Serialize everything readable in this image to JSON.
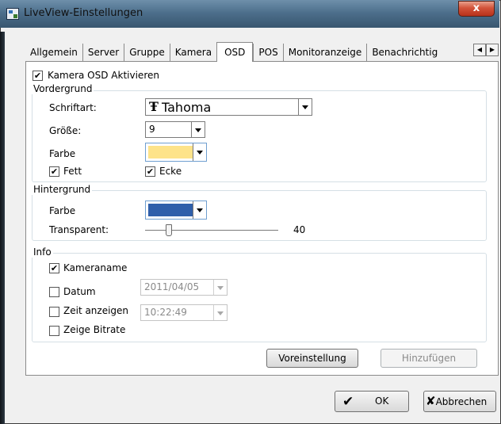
{
  "window": {
    "title": "LiveView-Einstellungen",
    "close_glyph": "x"
  },
  "tabs": [
    {
      "label": "Allgemein",
      "active": false
    },
    {
      "label": "Server",
      "active": false
    },
    {
      "label": "Gruppe",
      "active": false
    },
    {
      "label": "Kamera",
      "active": false
    },
    {
      "label": "OSD",
      "active": true
    },
    {
      "label": "POS",
      "active": false
    },
    {
      "label": "Monitoranzeige",
      "active": false
    },
    {
      "label": "Benachrichtig",
      "active": false
    }
  ],
  "tab_scroll": {
    "left": "◀",
    "right": "▶"
  },
  "osd": {
    "enable_label": "Kamera OSD Aktivieren",
    "enable_checked": true,
    "check_mark": "✔",
    "foreground": {
      "title": "Vordergrund",
      "font_label": "Schriftart:",
      "font_icon": "Ŧ",
      "font_value": "Tahoma",
      "size_label": "Größe:",
      "size_value": "9",
      "color_label": "Farbe",
      "color": "#fde38a",
      "bold_label": "Fett",
      "bold_checked": true,
      "corner_label": "Ecke",
      "corner_checked": true
    },
    "background": {
      "title": "Hintergrund",
      "color_label": "Farbe",
      "color": "#2f5faa",
      "transparent_label": "Transparent:",
      "transparent_value": "40",
      "transparent_fraction": 0.18
    },
    "info": {
      "title": "Info",
      "camera_name_label": "Kameraname",
      "camera_name_checked": true,
      "date_label": "Datum",
      "date_checked": false,
      "date_value": "2011/04/05",
      "time_label": "Zeit anzeigen",
      "time_checked": false,
      "time_value": "10:22:49",
      "bitrate_label": "Zeige Bitrate",
      "bitrate_checked": false
    },
    "default_button": "Voreinstellung",
    "add_button": "Hinzufügen"
  },
  "footer": {
    "ok_label": "OK",
    "ok_icon": "✔",
    "cancel_label": "Abbrechen",
    "cancel_icon": "✘"
  }
}
